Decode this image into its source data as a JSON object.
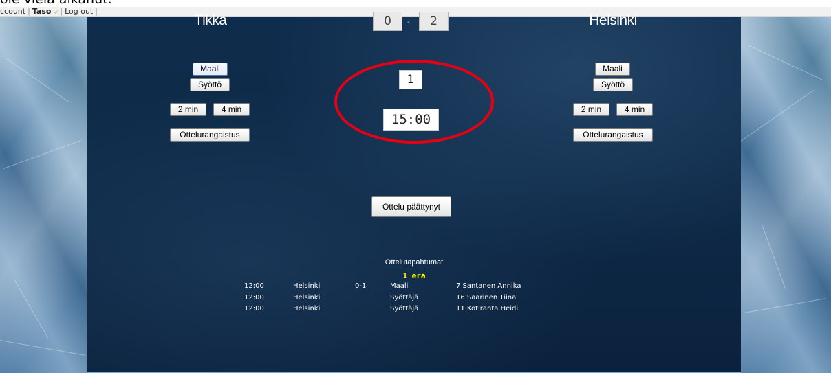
{
  "caption": "ole vielä alkanut.",
  "topbar": {
    "account": "ccount",
    "taso": "Taso",
    "logout": "Log out"
  },
  "home_team": {
    "name": "Tikka",
    "goal_label": "Maali",
    "assist_label": "Syöttö",
    "penalty2_label": "2 min",
    "penalty4_label": "4 min",
    "match_penalty_label": "Ottelurangaistus"
  },
  "away_team": {
    "name": "Helsinki",
    "goal_label": "Maali",
    "assist_label": "Syöttö",
    "penalty2_label": "2 min",
    "penalty4_label": "4 min",
    "match_penalty_label": "Ottelurangaistus"
  },
  "score": {
    "home": "0",
    "separator": "-",
    "away": "2"
  },
  "period": "1",
  "clock": "15:00",
  "end_match_label": "Ottelu päättynyt",
  "events": {
    "title": "Ottelutapahtumat",
    "period_label": "1 erä",
    "rows": [
      {
        "time": "12:00",
        "team": "Helsinki",
        "score": "0-1",
        "type": "Maali",
        "player": "7 Santanen Annika"
      },
      {
        "time": "12:00",
        "team": "Helsinki",
        "score": "",
        "type": "Syöttäjä",
        "player": "16 Saarinen Tiina"
      },
      {
        "time": "12:00",
        "team": "Helsinki",
        "score": "",
        "type": "Syöttäjä",
        "player": "11 Kotiranta Heidi"
      }
    ]
  },
  "colors": {
    "highlight_ring": "#e60012",
    "period_label": "#ffff00",
    "panel_background": "#0e2a48"
  }
}
